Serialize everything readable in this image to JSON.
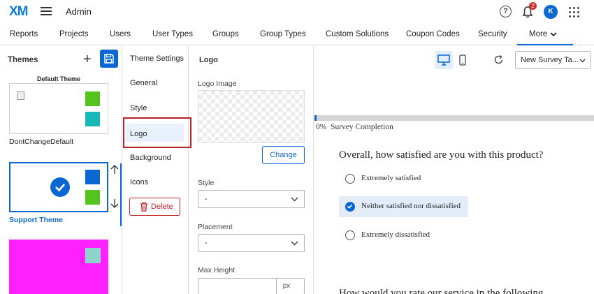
{
  "header": {
    "logo": "XM",
    "app_title": "Admin",
    "help_icon": "?",
    "notifications_count": "2",
    "avatar_initial": "K"
  },
  "nav": {
    "items": [
      "Reports",
      "Projects",
      "Users",
      "User Types",
      "Groups",
      "Group Types",
      "Custom Solutions",
      "Coupon Codes",
      "Security"
    ],
    "more_label": "More"
  },
  "themes": {
    "title": "Themes",
    "default_theme_label": "Default Theme",
    "cards": [
      {
        "name": "DontChangeDefault",
        "swatches": [
          "#54c31b",
          "#16b9b8"
        ]
      },
      {
        "name": "Support Theme",
        "swatches": [
          "#0b67d2",
          "#54c31b"
        ],
        "selected": true
      },
      {
        "name": "",
        "background": "#ff20ff",
        "swatches": [
          "#8fd3cd"
        ]
      }
    ]
  },
  "settings": {
    "title": "Theme Settings",
    "items": [
      "General",
      "Style",
      "Logo",
      "Background",
      "Icons"
    ],
    "active": "Logo",
    "delete_label": "Delete"
  },
  "logo_form": {
    "title": "Logo",
    "logo_image_label": "Logo Image",
    "change_label": "Change",
    "style_label": "Style",
    "style_value": "-",
    "placement_label": "Placement",
    "placement_value": "-",
    "max_height_label": "Max Height",
    "max_height_unit": "px"
  },
  "preview": {
    "template_select": "New Survey Ta...",
    "progress_percent": 0,
    "progress_label": "0%  Survey Completion",
    "question": "Overall, how satisfied are you with this product?",
    "choices": [
      "Extremely satisfied",
      "Neither satisfied nor dissatisfied",
      "Extremely dissatisfied"
    ],
    "selected_choice_index": 1,
    "next_question_partial": "How would you rate our service in the following"
  },
  "colors": {
    "accent": "#0b67d2",
    "highlight_border": "#b4222b",
    "delete": "#c0272d"
  }
}
